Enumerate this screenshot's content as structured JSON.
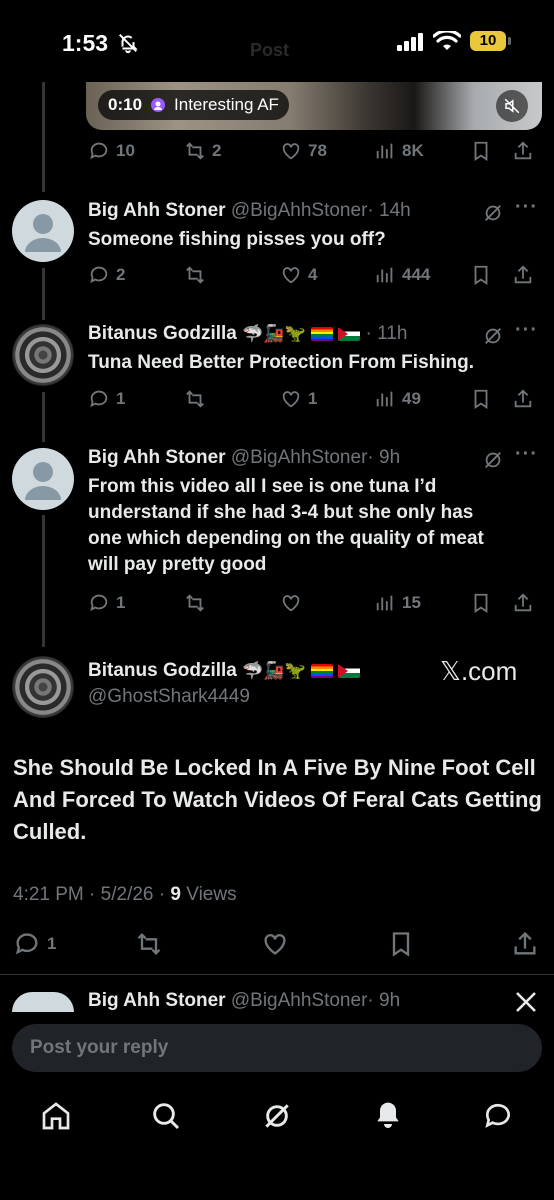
{
  "status_bar": {
    "time": "1:53",
    "battery": "10"
  },
  "header": {
    "title_faded": "Post"
  },
  "video": {
    "duration": "0:10",
    "space_label": "Interesting AF"
  },
  "video_post_actions": {
    "replies": "10",
    "reposts": "2",
    "likes": "78",
    "views": "8K"
  },
  "replies": [
    {
      "name": "Big Ahh Stoner",
      "handle": "@BigAhhStoner",
      "time": "· 14h",
      "text": "Someone fishing pisses you off?",
      "replies": "2",
      "reposts": "",
      "likes": "4",
      "views": "444"
    },
    {
      "name": "Bitanus Godzilla",
      "handle": "",
      "time": "· 11h",
      "text": "Tuna Need Better Protection From Fishing.",
      "replies": "1",
      "reposts": "",
      "likes": "1",
      "views": "49"
    },
    {
      "name": "Big Ahh Stoner",
      "handle": "@BigAhhStoner",
      "time": "· 9h",
      "text_lines": [
        "From this video all I see is one tuna I’d",
        "understand if she had 3-4 but she only has",
        "one which depending on the quality of meat",
        "will pay pretty good"
      ],
      "replies": "1",
      "reposts": "",
      "likes": "",
      "views": "15"
    }
  ],
  "main_post": {
    "name": "Bitanus Godzilla",
    "handle": "@GhostShark4449",
    "text": "She Should Be Locked In A Five By Nine Foot Cell And Forced To Watch Videos Of Feral Cats Getting Culled.",
    "time": "4:21 PM",
    "date": "5/2/26",
    "views": "9",
    "views_label": "Views",
    "replies": "1"
  },
  "watermark": "𝕏.com",
  "next_reply": {
    "name": "Big Ahh Stoner",
    "handle": "@BigAhhStoner",
    "time": "· 9h"
  },
  "composer": {
    "placeholder": "Post your reply"
  },
  "colors": {
    "background": "#000000",
    "text": "#e7e9ea",
    "muted": "#71767b",
    "battery": "#e9c83c"
  },
  "icons": [
    "bell-slash-icon",
    "signal-icon",
    "wifi-icon",
    "reply-icon",
    "repost-icon",
    "like-icon",
    "views-icon",
    "bookmark-icon",
    "share-icon",
    "grok-icon",
    "more-icon",
    "home-icon",
    "search-icon",
    "notifications-icon",
    "messages-icon",
    "close-icon"
  ]
}
